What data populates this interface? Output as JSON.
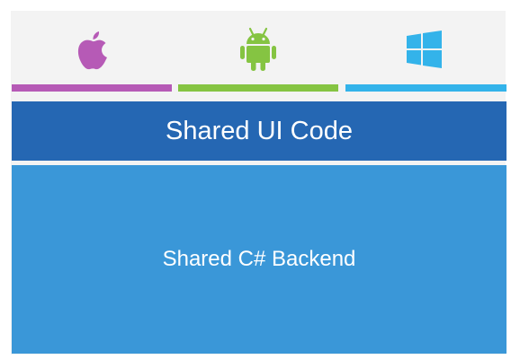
{
  "colors": {
    "ios": "#b65ab6",
    "android": "#85c442",
    "windows": "#33b3ea",
    "ui_layer": "#2567b3",
    "backend_layer": "#3a97d8"
  },
  "icons": {
    "ios": "apple-icon",
    "android": "android-icon",
    "windows": "windows-icon"
  },
  "layers": {
    "ui": "Shared UI Code",
    "backend": "Shared C# Backend"
  }
}
